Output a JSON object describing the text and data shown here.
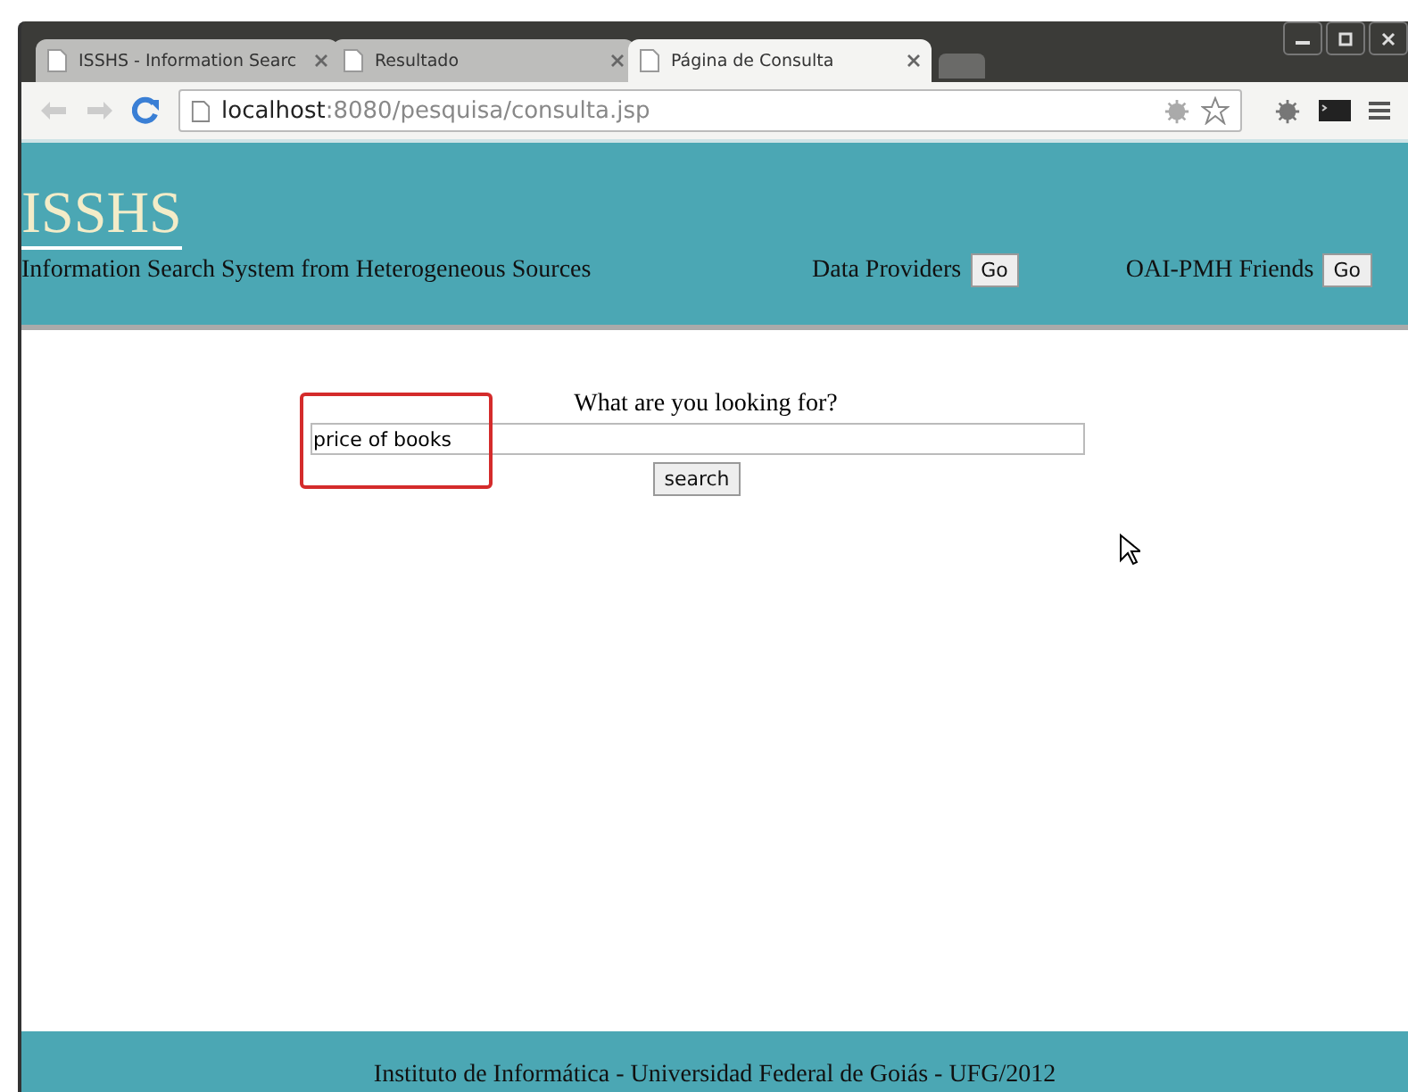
{
  "tabs": [
    {
      "label": "ISSHS - Information Searc",
      "selected": false
    },
    {
      "label": "Resultado",
      "selected": false
    },
    {
      "label": "Página de Consulta",
      "selected": true
    }
  ],
  "address": {
    "host": "localhost",
    "path": ":8080/pesquisa/consulta.jsp"
  },
  "header": {
    "logo": "ISSHS",
    "subtitle": "Information Search System from Heterogeneous Sources",
    "links": [
      {
        "label": "Data Providers",
        "button": "Go"
      },
      {
        "label": "OAI-PMH Friends",
        "button": "Go"
      }
    ]
  },
  "search": {
    "label": "What are you looking for?",
    "value": "price of books",
    "button": "search"
  },
  "footer": "Instituto de Informática - Universidad Federal de Goiás - UFG/2012"
}
